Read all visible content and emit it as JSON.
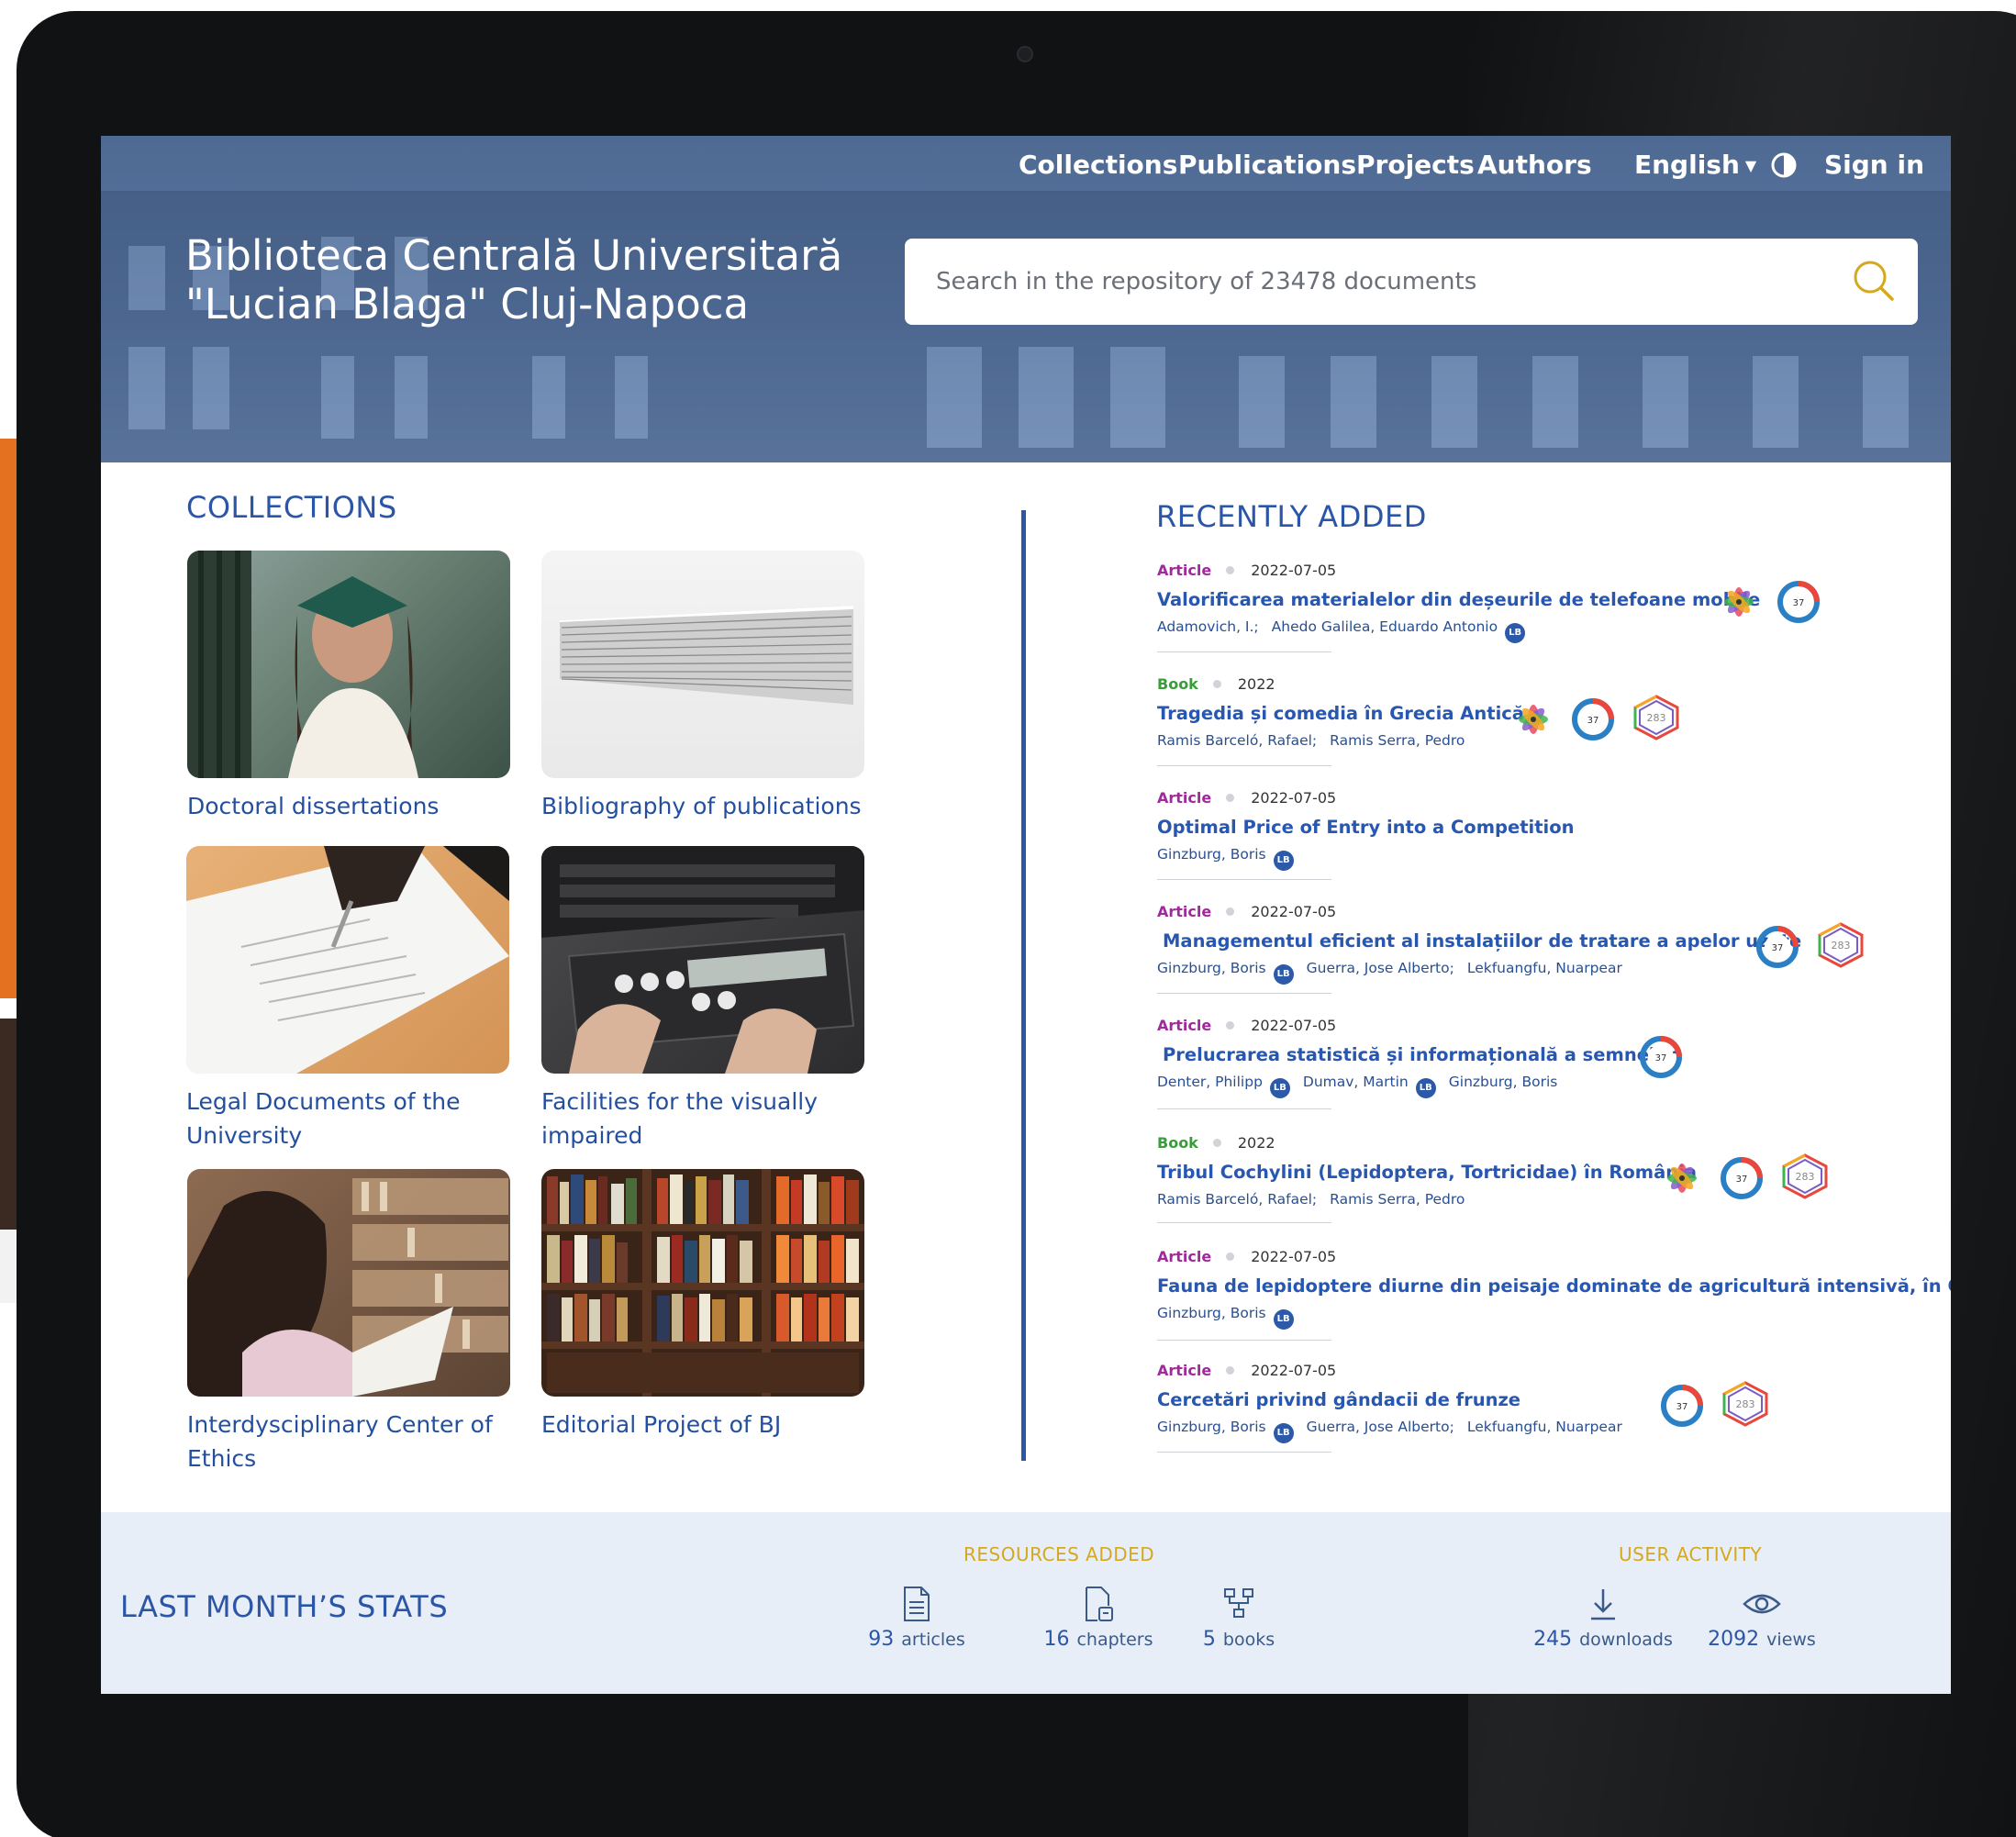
{
  "nav": {
    "collections": "Collections",
    "publications": "Publications",
    "projects": "Projects",
    "authors": "Authors",
    "language": "English",
    "sign_in": "Sign in"
  },
  "brand": {
    "line1": "Biblioteca Centrală Universitară",
    "line2": "\"Lucian Blaga\" Cluj-Napoca"
  },
  "search": {
    "placeholder": "Search in the repository of 23478 documents"
  },
  "collections": {
    "title": "COLLECTIONS",
    "items": [
      {
        "line1": "Doctoral dissertations",
        "line2": ""
      },
      {
        "line1": "Bibliography of publications",
        "line2": ""
      },
      {
        "line1": "Legal Documents of the",
        "line2": "University"
      },
      {
        "line1": "Facilities for the visually",
        "line2": "impaired"
      },
      {
        "line1": "Interdysciplinary Center of",
        "line2": "Ethics"
      },
      {
        "line1": "Editorial Project of BJ",
        "line2": ""
      }
    ]
  },
  "recent": {
    "title": "RECENTLY ADDED",
    "items": [
      {
        "type": "Article",
        "date": "2022-07-05",
        "title": "Valorificarea materialelor din deșeurile de telefoane mobile",
        "authors": [
          "Adamovich, I.;",
          "Ahedo Galilea, Eduardo Antonio"
        ]
      },
      {
        "type": "Book",
        "date": "2022",
        "title": "Tragedia și comedia în Grecia Antică",
        "authors": [
          "Ramis Barceló, Rafael;",
          "Ramis Serra, Pedro"
        ]
      },
      {
        "type": "Article",
        "date": "2022-07-05",
        "title": "Optimal Price of Entry into a Competition",
        "authors": [
          "Ginzburg, Boris"
        ]
      },
      {
        "type": "Article",
        "date": "2022-07-05",
        "title": "Managementul eficient al instalațiilor de tratare a apelor uzate",
        "authors": [
          "Ginzburg, Boris",
          "Guerra, Jose Alberto;",
          "Lekfuangfu, Nuarpear"
        ]
      },
      {
        "type": "Article",
        "date": "2022-07-05",
        "title": "Prelucrarea statistică și informațională a semnelor",
        "authors": [
          "Denter, Philipp",
          "Dumav, Martin",
          "Ginzburg, Boris"
        ]
      },
      {
        "type": "Book",
        "date": "2022",
        "title": "Tribul Cochylini (Lepidoptera, Tortricidae) în România",
        "authors": [
          "Ramis Barceló, Rafael;",
          "Ramis Serra, Pedro"
        ]
      },
      {
        "type": "Article",
        "date": "2022-07-05",
        "title": "Fauna de lepidoptere diurne din peisaje dominate de agricultură intensivă, în Cluj",
        "authors": [
          "Ginzburg, Boris"
        ]
      },
      {
        "type": "Article",
        "date": "2022-07-05",
        "title": "Cercetări privind gândacii de frunze",
        "authors": [
          "Ginzburg, Boris",
          "Guerra, Jose Alberto;",
          "Lekfuangfu, Nuarpear"
        ]
      }
    ],
    "badge_label": "LB",
    "metric_dimensions": "37",
    "metric_plumx": "283"
  },
  "stats": {
    "title": "LAST MONTH’S STATS",
    "resources_heading": "RESOURCES ADDED",
    "activity_heading": "USER ACTIVITY",
    "articles_num": "93",
    "articles_label": "articles",
    "chapters_num": "16",
    "chapters_label": "chapters",
    "books_num": "5",
    "books_label": "books",
    "downloads_num": "245",
    "downloads_label": "downloads",
    "views_num": "2092",
    "views_label": "views"
  },
  "colors": {
    "accent": "#2b55a6",
    "gold": "#d4a91f",
    "hero": "#56729c",
    "article": "#a0299b",
    "book": "#3a9c3a"
  }
}
